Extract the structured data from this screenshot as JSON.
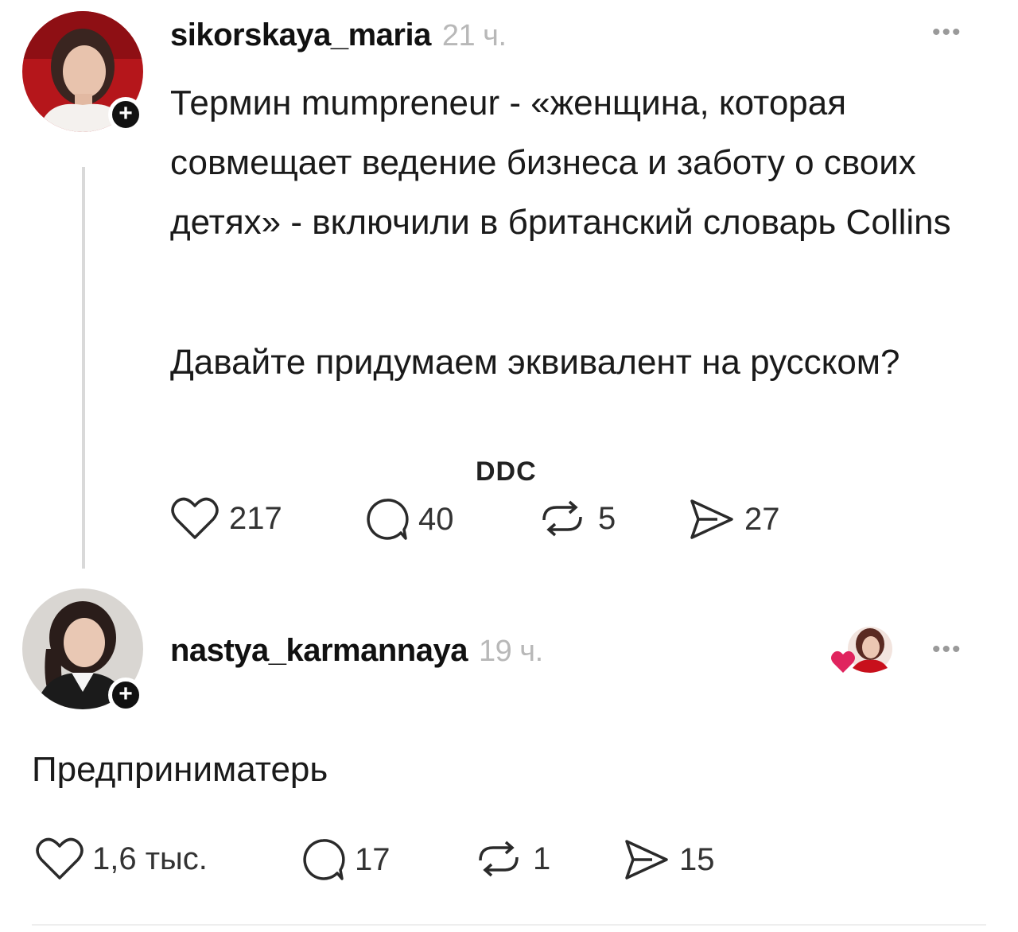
{
  "post": {
    "username": "sikorskaya_maria",
    "time": "21 ч.",
    "paragraph1": "Термин mumpreneur - «женщина, которая совмещает ведение бизнеса и заботу о своих детях» - включили в британский словарь Collins",
    "paragraph2": "Давайте придумаем эквивалент на русском?",
    "watermark": "DDC",
    "likes": "217",
    "comments": "40",
    "reposts": "5",
    "shares": "27"
  },
  "reply": {
    "username": "nastya_karmannaya",
    "time": "19 ч.",
    "text": "Предприниматерь",
    "likes": "1,6 тыс.",
    "comments": "17",
    "reposts": "1",
    "shares": "15"
  },
  "icons": [
    "plus-icon",
    "more-icon",
    "heart-icon",
    "comment-icon",
    "repost-icon",
    "share-icon",
    "liked-by-author-avatar"
  ],
  "colors": {
    "text": "#1a1a1a",
    "muted": "#b8b8b8",
    "heart": "#e0245e",
    "thread_line": "#d9d9d9"
  }
}
